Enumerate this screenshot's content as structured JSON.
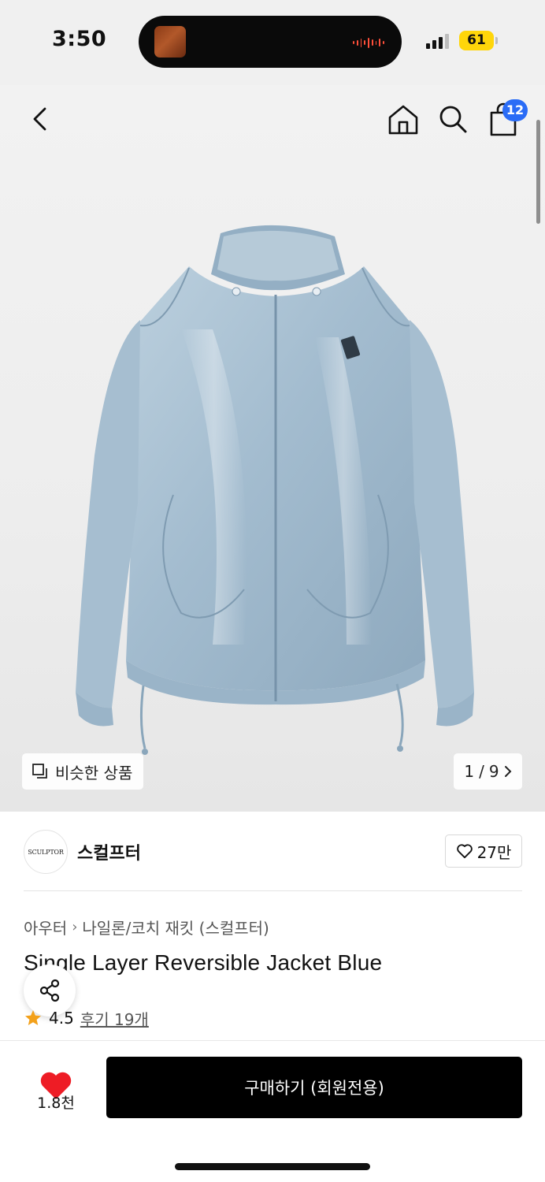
{
  "status_bar": {
    "time": "3:50",
    "battery": "61",
    "icons": [
      "signal-icon",
      "battery-icon"
    ]
  },
  "header": {
    "icons": [
      "back-arrow-icon",
      "home-icon",
      "search-icon",
      "shopping-bag-icon"
    ],
    "cart_count": "12"
  },
  "gallery": {
    "similar_label": "비슷한 상품",
    "current_page": "1",
    "separator": "/",
    "total_pages": "9",
    "product_color": "#a9c1d4"
  },
  "brand": {
    "logo_text": "SCULPTOR",
    "name": "스컬프터",
    "like_count": "27만"
  },
  "product": {
    "breadcrumb": [
      "아우터",
      "나일론/코치 재킷 (스컬프터)"
    ],
    "title": "Single Layer Reversible Jacket Blue",
    "rating": "4.5",
    "review_link": "후기 19개"
  },
  "bottom_bar": {
    "wish_count": "1.8천",
    "buy_label": "구매하기 (회원전용)"
  },
  "colors": {
    "accent_blue": "#2a6cf6",
    "heart_red": "#ee1c25",
    "star_orange": "#f3a11b",
    "battery_yellow": "#ffd60a"
  }
}
